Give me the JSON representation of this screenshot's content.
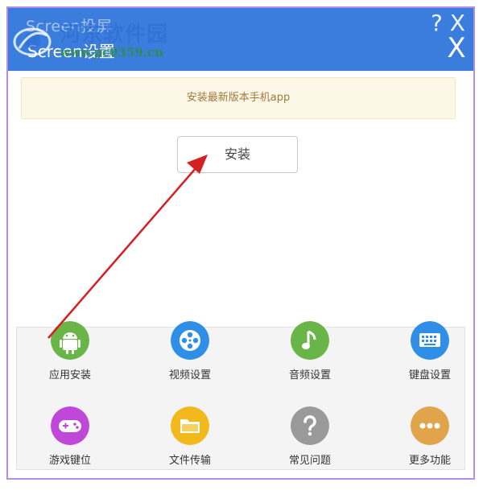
{
  "window": {
    "title_back": "Screen投屏",
    "title_front": "Screen设置",
    "title_back_icons": "? X",
    "close_label": "X"
  },
  "watermark": {
    "name": "河东软件园",
    "url": "www.pc0359.cn"
  },
  "notice": {
    "text": "安装最新版本手机app"
  },
  "install_button": {
    "label": "安装"
  },
  "features": [
    {
      "label": "应用安装",
      "icon": "android-icon",
      "color": "#6ab547"
    },
    {
      "label": "视频设置",
      "icon": "film-reel-icon",
      "color": "#2f8ee6"
    },
    {
      "label": "音频设置",
      "icon": "music-note-icon",
      "color": "#6ab547"
    },
    {
      "label": "键盘设置",
      "icon": "keyboard-icon",
      "color": "#2f8ee6"
    },
    {
      "label": "游戏键位",
      "icon": "gamepad-icon",
      "color": "#c048d8"
    },
    {
      "label": "文件传输",
      "icon": "folder-icon",
      "color": "#f2b91d"
    },
    {
      "label": "常见问题",
      "icon": "question-icon",
      "color": "#9a9a9a"
    },
    {
      "label": "更多功能",
      "icon": "more-dots-icon",
      "color": "#e0a44a"
    }
  ],
  "colors": {
    "titlebar": "#3b7ddd",
    "window_border": "#b38ee6",
    "notice_bg": "#fcf7e6",
    "notice_text": "#a07a3c",
    "annotation_arrow": "#d42020"
  }
}
